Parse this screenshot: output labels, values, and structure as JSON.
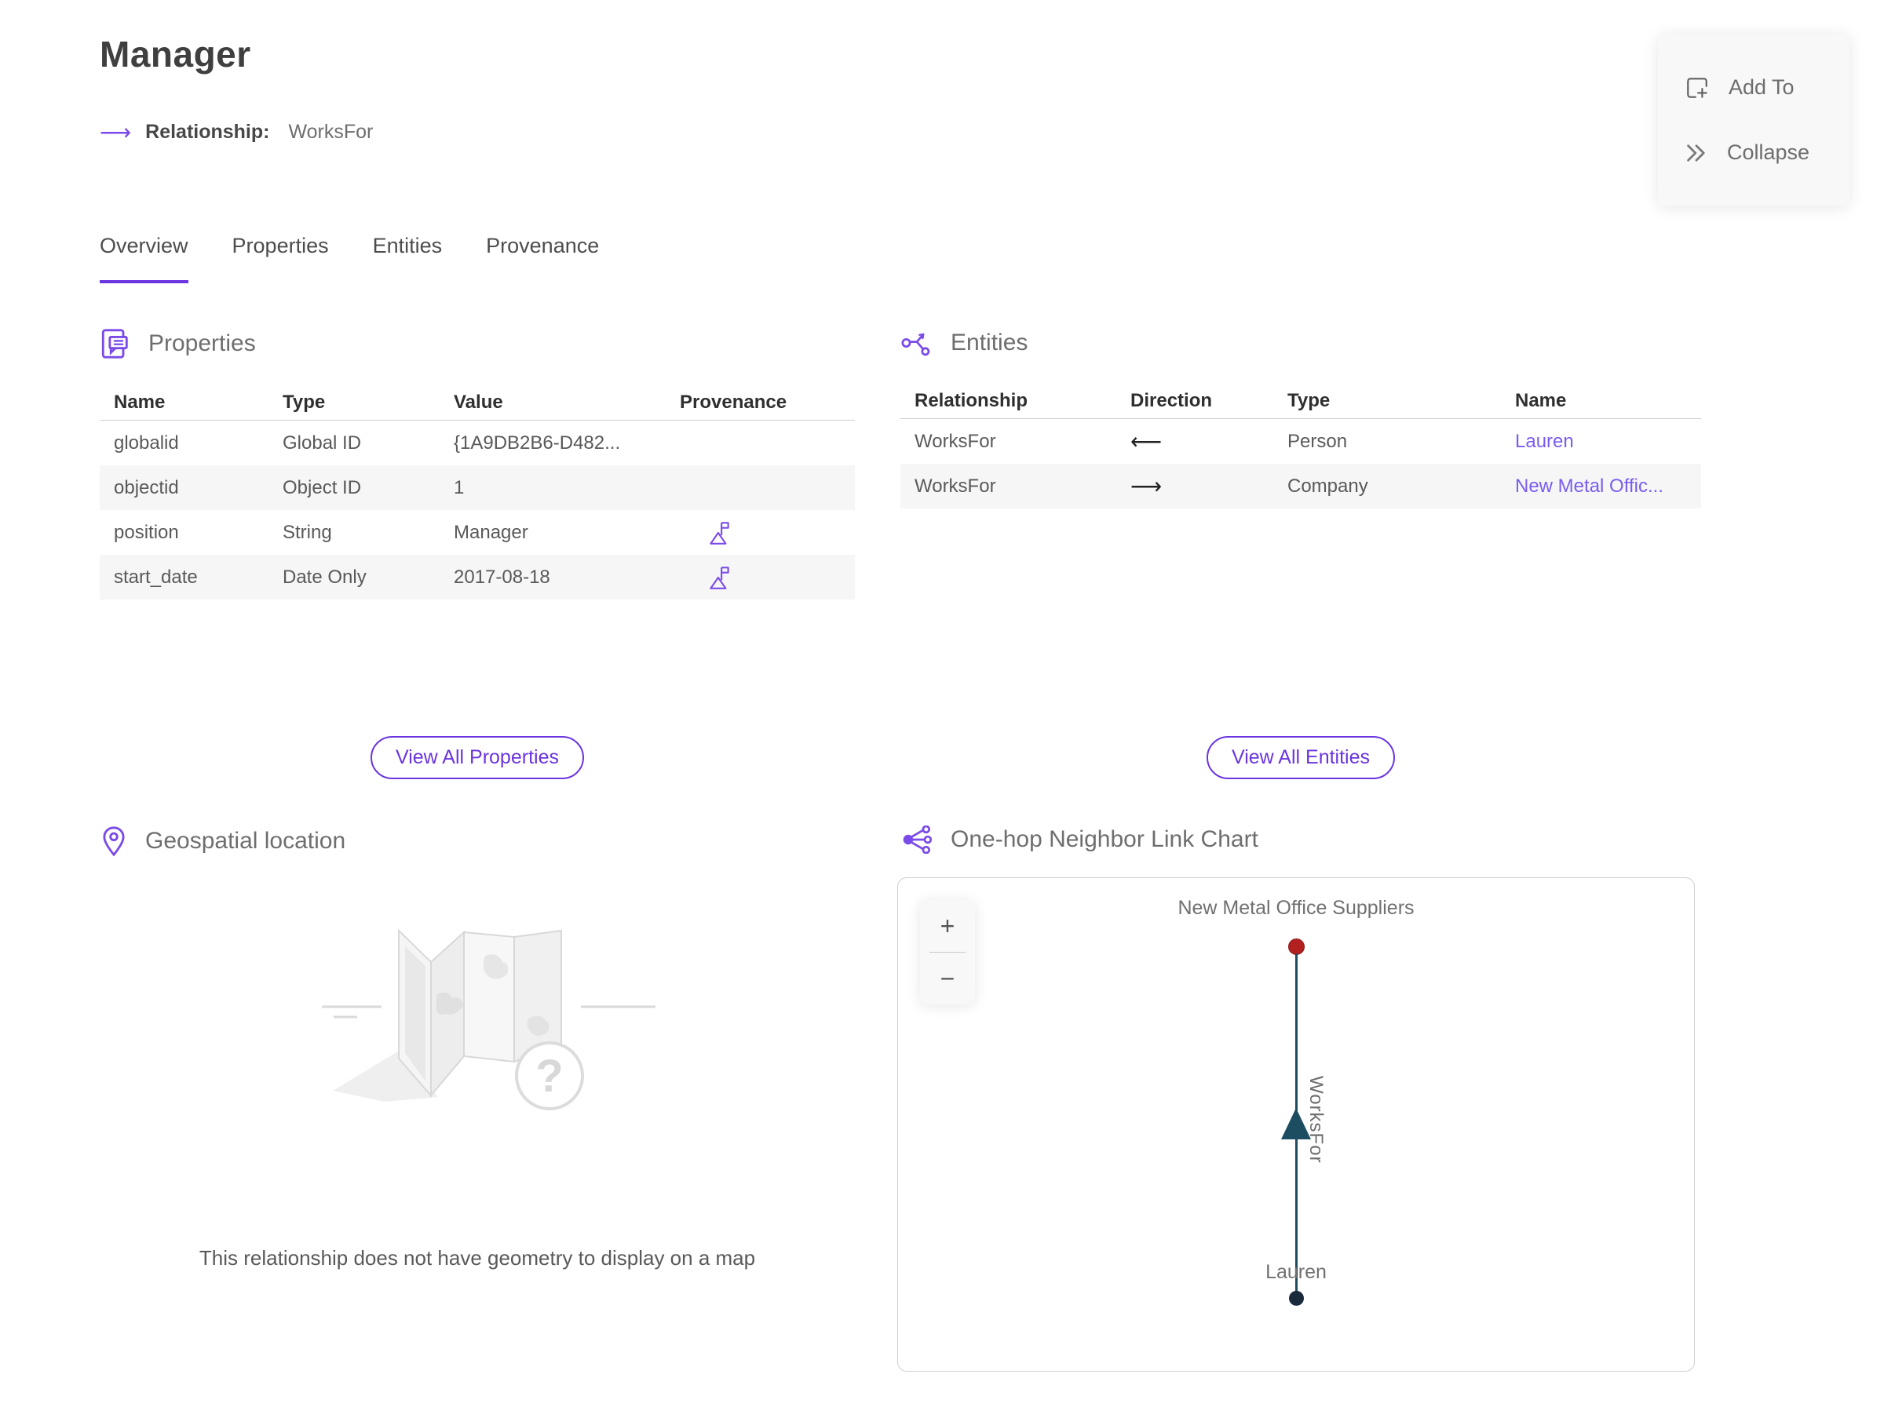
{
  "page": {
    "title": "Manager",
    "subtitle_label": "Relationship:",
    "subtitle_value": "WorksFor"
  },
  "actions": {
    "add_to": "Add To",
    "collapse": "Collapse"
  },
  "tabs": [
    {
      "label": "Overview",
      "active": true
    },
    {
      "label": "Properties",
      "active": false
    },
    {
      "label": "Entities",
      "active": false
    },
    {
      "label": "Provenance",
      "active": false
    }
  ],
  "properties_section": {
    "title": "Properties",
    "columns": [
      "Name",
      "Type",
      "Value",
      "Provenance"
    ],
    "rows": [
      {
        "name": "globalid",
        "type": "Global ID",
        "value": "{1A9DB2B6-D482...",
        "has_provenance": false
      },
      {
        "name": "objectid",
        "type": "Object ID",
        "value": "1",
        "has_provenance": false
      },
      {
        "name": "position",
        "type": "String",
        "value": "Manager",
        "has_provenance": true
      },
      {
        "name": "start_date",
        "type": "Date Only",
        "value": "2017-08-18",
        "has_provenance": true
      }
    ],
    "view_all_label": "View All Properties"
  },
  "entities_section": {
    "title": "Entities",
    "columns": [
      "Relationship",
      "Direction",
      "Type",
      "Name"
    ],
    "rows": [
      {
        "relationship": "WorksFor",
        "direction": "⟵",
        "type": "Person",
        "name": "Lauren"
      },
      {
        "relationship": "WorksFor",
        "direction": "⟶",
        "type": "Company",
        "name": "New Metal Offic..."
      }
    ],
    "view_all_label": "View All Entities"
  },
  "geospatial_section": {
    "title": "Geospatial location",
    "empty_message": "This relationship does not have geometry to display on a map"
  },
  "link_chart_section": {
    "title": "One-hop Neighbor Link Chart",
    "zoom_in": "+",
    "zoom_out": "−",
    "chart_data": {
      "type": "link-chart",
      "nodes": [
        {
          "label": "New Metal Office Suppliers",
          "entity_type": "Company",
          "color": "#b2201f",
          "position": "top"
        },
        {
          "label": "Lauren",
          "entity_type": "Person",
          "color": "#182a3c",
          "position": "bottom"
        }
      ],
      "edges": [
        {
          "label": "WorksFor",
          "from": "Lauren",
          "to": "New Metal Office Suppliers",
          "direction": "up",
          "color": "#1d4d60"
        }
      ]
    }
  },
  "colors": {
    "accent_purple": "#6a35e0",
    "link_purple": "#7a5cf0",
    "icon_purple": "#7a4be8",
    "edge_teal": "#1d4d60",
    "node_company_red": "#b2201f",
    "node_person_navy": "#182a3c",
    "row_alt_bg": "#f6f6f6"
  }
}
